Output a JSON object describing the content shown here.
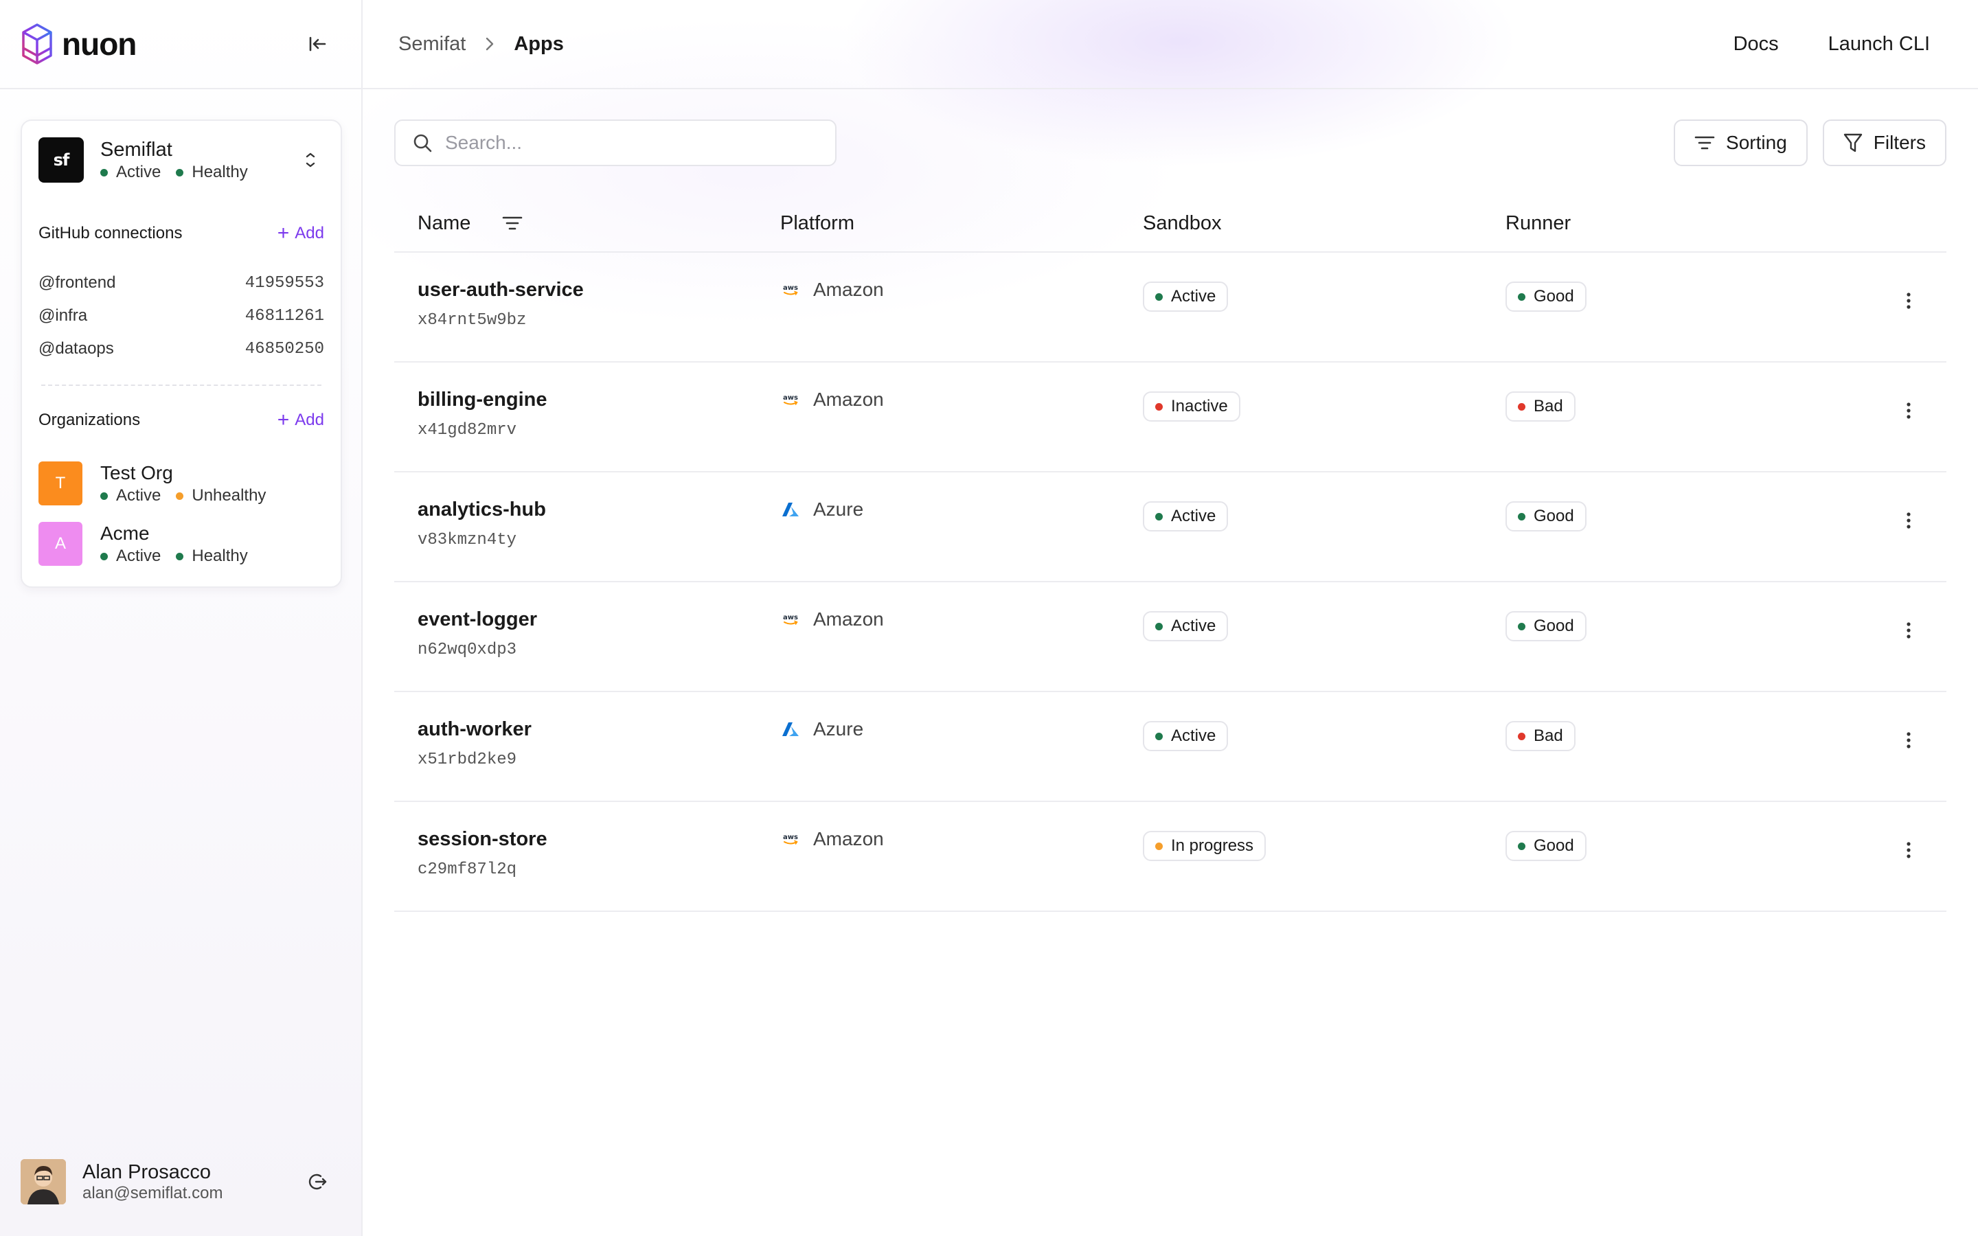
{
  "brand": {
    "name": "nuon"
  },
  "colors": {
    "accent": "#7c3aed",
    "active": "#1f7a4d",
    "healthy": "#1f7a4d",
    "unhealthy": "#f59e2b",
    "bad": "#e0382b",
    "in_progress": "#f59e2b"
  },
  "current_org": {
    "initials": "sf",
    "name": "Semiflat",
    "status": "Active",
    "health": "Healthy"
  },
  "github": {
    "title": "GitHub connections",
    "add_label": "Add",
    "items": [
      {
        "name": "@frontend",
        "id": "41959553"
      },
      {
        "name": "@infra",
        "id": "46811261"
      },
      {
        "name": "@dataops",
        "id": "46850250"
      }
    ]
  },
  "organizations": {
    "title": "Organizations",
    "add_label": "Add",
    "items": [
      {
        "initial": "T",
        "name": "Test Org",
        "status": "Active",
        "health": "Unhealthy",
        "color": "#fb8c1e",
        "health_color": "#f59e2b"
      },
      {
        "initial": "A",
        "name": "Acme",
        "status": "Active",
        "health": "Healthy",
        "color": "#ee8cf0",
        "health_color": "#1f7a4d"
      }
    ]
  },
  "user": {
    "name": "Alan Prosacco",
    "email": "alan@semiflat.com"
  },
  "breadcrumb": {
    "org": "Semifat",
    "page": "Apps"
  },
  "top_links": {
    "docs": "Docs",
    "cli": "Launch CLI"
  },
  "search": {
    "placeholder": "Search...",
    "value": ""
  },
  "toolbar": {
    "sorting_label": "Sorting",
    "filters_label": "Filters"
  },
  "table": {
    "columns": {
      "name": "Name",
      "platform": "Platform",
      "sandbox": "Sandbox",
      "runner": "Runner"
    },
    "rows": [
      {
        "name": "user-auth-service",
        "id": "x84rnt5w9bz",
        "platform": "Amazon",
        "platform_icon": "aws-icon",
        "sandbox": "Active",
        "sandbox_color": "#1f7a4d",
        "runner": "Good",
        "runner_color": "#1f7a4d"
      },
      {
        "name": "billing-engine",
        "id": "x41gd82mrv",
        "platform": "Amazon",
        "platform_icon": "aws-icon",
        "sandbox": "Inactive",
        "sandbox_color": "#e0382b",
        "runner": "Bad",
        "runner_color": "#e0382b"
      },
      {
        "name": "analytics-hub",
        "id": "v83kmzn4ty",
        "platform": "Azure",
        "platform_icon": "azure-icon",
        "sandbox": "Active",
        "sandbox_color": "#1f7a4d",
        "runner": "Good",
        "runner_color": "#1f7a4d"
      },
      {
        "name": "event-logger",
        "id": "n62wq0xdp3",
        "platform": "Amazon",
        "platform_icon": "aws-icon",
        "sandbox": "Active",
        "sandbox_color": "#1f7a4d",
        "runner": "Good",
        "runner_color": "#1f7a4d"
      },
      {
        "name": "auth-worker",
        "id": "x51rbd2ke9",
        "platform": "Azure",
        "platform_icon": "azure-icon",
        "sandbox": "Active",
        "sandbox_color": "#1f7a4d",
        "runner": "Bad",
        "runner_color": "#e0382b"
      },
      {
        "name": "session-store",
        "id": "c29mf87l2q",
        "platform": "Amazon",
        "platform_icon": "aws-icon",
        "sandbox": "In progress",
        "sandbox_color": "#f59e2b",
        "runner": "Good",
        "runner_color": "#1f7a4d"
      }
    ]
  }
}
